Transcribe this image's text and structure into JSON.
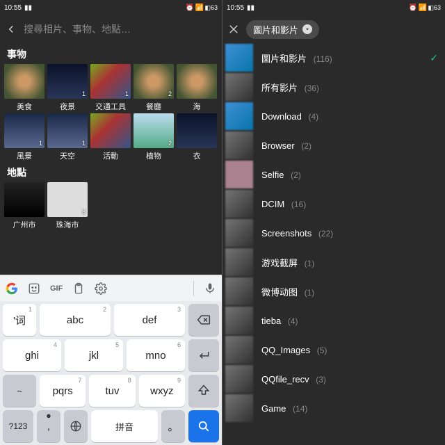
{
  "status": {
    "time": "10:55",
    "battery": "63"
  },
  "left": {
    "search_placeholder": "搜尋相片、事物、地點…",
    "sections": {
      "things": "事物",
      "places": "地點"
    },
    "things_row1": [
      {
        "label": "美食",
        "count": ""
      },
      {
        "label": "夜景",
        "count": "1"
      },
      {
        "label": "交通工具",
        "count": "1"
      },
      {
        "label": "餐廳",
        "count": "2"
      },
      {
        "label": "海",
        "count": ""
      }
    ],
    "things_row2": [
      {
        "label": "風景",
        "count": "1"
      },
      {
        "label": "天空",
        "count": "1"
      },
      {
        "label": "活動",
        "count": ""
      },
      {
        "label": "植物",
        "count": "2"
      },
      {
        "label": "衣",
        "count": ""
      }
    ],
    "places": [
      {
        "label": "广州市",
        "count": ""
      },
      {
        "label": "珠海市",
        "count": "8"
      }
    ]
  },
  "keyboard": {
    "row1": [
      {
        "main": "'词",
        "sup": "1"
      },
      {
        "main": "abc",
        "sup": "2"
      },
      {
        "main": "def",
        "sup": "3"
      }
    ],
    "row2": [
      {
        "main": "ghi",
        "sup": "4"
      },
      {
        "main": "jkl",
        "sup": "5"
      },
      {
        "main": "mno",
        "sup": "6"
      }
    ],
    "row3": [
      {
        "main": "pqrs",
        "sup": "7"
      },
      {
        "main": "tuv",
        "sup": "8"
      },
      {
        "main": "wxyz",
        "sup": "9"
      }
    ],
    "sym": "?123",
    "space": "拼音",
    "gif": "GIF",
    "comma": ",",
    "dot": "。",
    "tilde": "~"
  },
  "right": {
    "chip": "圖片和影片",
    "albums": [
      {
        "label": "圖片和影片",
        "count": "(116)",
        "checked": true
      },
      {
        "label": "所有影片",
        "count": "(36)"
      },
      {
        "label": "Download",
        "count": "(4)"
      },
      {
        "label": "Browser",
        "count": "(2)"
      },
      {
        "label": "Selfie",
        "count": "(2)"
      },
      {
        "label": "DCIM",
        "count": "(16)"
      },
      {
        "label": "Screenshots",
        "count": "(22)"
      },
      {
        "label": "游戏截屏",
        "count": "(1)"
      },
      {
        "label": "微博动图",
        "count": "(1)"
      },
      {
        "label": "tieba",
        "count": "(4)"
      },
      {
        "label": "QQ_Images",
        "count": "(5)"
      },
      {
        "label": "QQfile_recv",
        "count": "(3)"
      },
      {
        "label": "Game",
        "count": "(14)"
      }
    ]
  }
}
